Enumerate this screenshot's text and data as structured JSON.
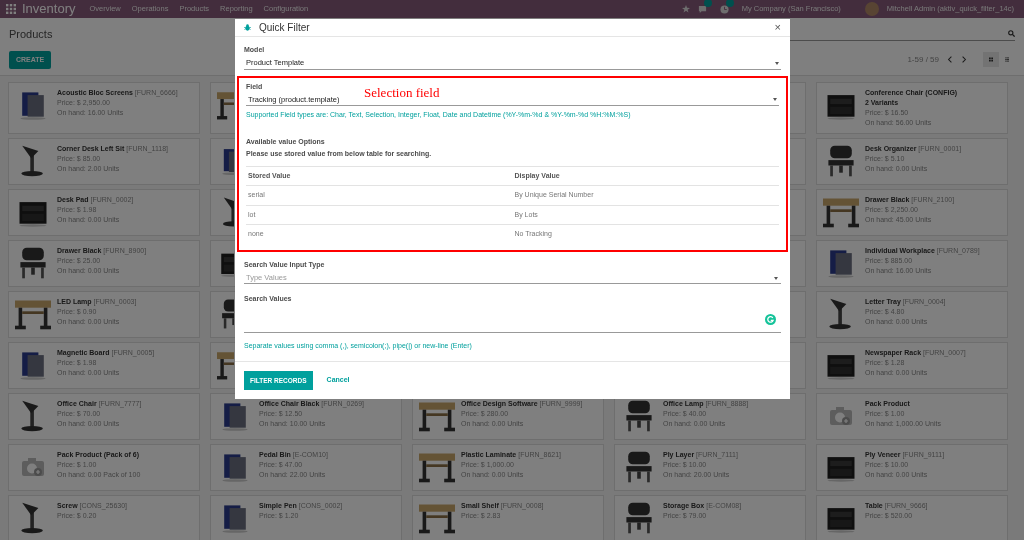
{
  "app": {
    "name": "Inventory",
    "menu": [
      "Overview",
      "Operations",
      "Products",
      "Reporting",
      "Configuration"
    ],
    "company": "My Company (San Francisco)",
    "user": "Mitchell Admin (aktiv_quick_filter_14c)"
  },
  "control_panel": {
    "title": "Products",
    "create_button": "CREATE",
    "pager": "1-59 / 59",
    "views": [
      {
        "kind": "kanban",
        "selected": true
      },
      {
        "kind": "list",
        "selected": false
      }
    ]
  },
  "products": [
    {
      "name": "Acoustic Bloc Screens",
      "code": "[FURN_6666]",
      "price": "Price: $ 2,950.00",
      "on_hand": "On hand: 16.00 Units"
    },
    {
      "kind": "covered"
    },
    {
      "kind": "covered"
    },
    {
      "name": "Conference Chair (CONFIG)",
      "variants": "2 Variants",
      "price": "Price: $ 16.50",
      "on_hand": "On hand: 56.00 Units"
    },
    {
      "name": "Corner Desk Left Sit",
      "code": "[FURN_1118]",
      "price": "Price: $ 85.00",
      "on_hand": "On hand: 2.00 Units"
    },
    {
      "kind": "covered"
    },
    {
      "kind": "covered"
    },
    {
      "name": "Desk Organizer",
      "code": "[FURN_0001]",
      "price": "Price: $ 5.10",
      "on_hand": "On hand: 0.00 Units"
    },
    {
      "name": "Desk Pad",
      "code": "[FURN_0002]",
      "price": "Price: $ 1.98",
      "on_hand": "On hand: 0.00 Units"
    },
    {
      "kind": "covered"
    },
    {
      "kind": "covered"
    },
    {
      "name": "Drawer Black",
      "code": "[FURN_2100]",
      "price": "Price: $ 2,250.00",
      "on_hand": "On hand: 45.00 Units"
    },
    {
      "name": "Drawer Black",
      "code": "[FURN_8900]",
      "price": "Price: $ 25.00",
      "on_hand": "On hand: 0.00 Units"
    },
    {
      "kind": "covered"
    },
    {
      "kind": "covered"
    },
    {
      "name": "Individual Workplace",
      "code": "[FURN_0789]",
      "price": "Price: $ 885.00",
      "on_hand": "On hand: 16.00 Units"
    },
    {
      "name": "LED Lamp",
      "code": "[FURN_0003]",
      "price": "Price: $ 0.90",
      "on_hand": "On hand: 0.00 Units"
    },
    {
      "kind": "covered"
    },
    {
      "kind": "covered"
    },
    {
      "name": "Letter Tray",
      "code": "[FURN_0004]",
      "price": "Price: $ 4.80",
      "on_hand": "On hand: 0.00 Units"
    },
    {
      "name": "Magnetic Board",
      "code": "[FURN_0005]",
      "price": "Price: $ 1.98",
      "on_hand": "On hand: 0.00 Units"
    },
    {
      "kind": "covered"
    },
    {
      "kind": "covered"
    },
    {
      "name": "Newspaper Rack",
      "code": "[FURN_0007]",
      "price": "Price: $ 1.28",
      "on_hand": "On hand: 0.00 Units"
    },
    {
      "name": "Office Chair",
      "code": "[FURN_7777]",
      "price": "Price: $ 70.00",
      "on_hand": "On hand: 0.00 Units"
    },
    {
      "name": "Office Chair Black",
      "code": "[FURN_0269]",
      "price": "Price: $ 12.50",
      "on_hand": "On hand: 10.00 Units"
    },
    {
      "name": "Office Design Software",
      "code": "[FURN_9999]",
      "price": "Price: $ 280.00",
      "on_hand": "On hand: 0.00 Units"
    },
    {
      "name": "Office Lamp",
      "code": "[FURN_8888]",
      "price": "Price: $ 40.00",
      "on_hand": "On hand: 0.00 Units"
    },
    {
      "kind": "placeholder",
      "name": "Pack Product",
      "price": "Price: $ 1.00",
      "on_hand": "On hand: 1,000.00 Units"
    },
    {
      "kind": "placeholder",
      "name": "Pack Product (Pack of 6)",
      "price": "Price: $ 1.00",
      "on_hand": "On hand: 0.00 Pack of 100"
    },
    {
      "name": "Pedal Bin",
      "code": "[E-COM10]",
      "price": "Price: $ 47.00",
      "on_hand": "On hand: 22.00 Units"
    },
    {
      "name": "Plastic Laminate",
      "code": "[FURN_8621]",
      "price": "Price: $ 1,000.00",
      "on_hand": "On hand: 0.00 Units"
    },
    {
      "name": "Ply Layer",
      "code": "[FURN_7111]",
      "price": "Price: $ 10.00",
      "on_hand": "On hand: 20.00 Units"
    },
    {
      "name": "Ply Veneer",
      "code": "[FURN_9111]",
      "price": "Price: $ 10.00",
      "on_hand": "On hand: 0.00 Units"
    },
    {
      "name": "Screw",
      "code": "[CONS_25630]",
      "price": "Price: $ 0.20"
    },
    {
      "name": "Simple Pen",
      "code": "[CONS_0002]",
      "price": "Price: $ 1.20"
    },
    {
      "name": "Small Shelf",
      "code": "[FURN_0008]",
      "price": "Price: $ 2.83"
    },
    {
      "name": "Storage Box",
      "code": "[E-COM08]",
      "price": "Price: $ 79.00"
    },
    {
      "name": "Table",
      "code": "[FURN_9666]",
      "price": "Price: $ 520.00"
    }
  ],
  "dialog": {
    "title": "Quick Filter",
    "close": "×",
    "model": {
      "label": "Model",
      "value": "Product Template"
    },
    "field": {
      "label": "Field",
      "value": "Tracking (product.template)",
      "help": "Supported Field types are: Char, Text, Selection, Integer, Float, Date and Datetime (%Y-%m-%d & %Y-%m-%d %H:%M:%S)"
    },
    "options": {
      "title": "Available value Options",
      "note": "Please use stored value from below table for searching.",
      "columns": [
        "Stored Value",
        "Display Value"
      ],
      "rows": [
        [
          "serial",
          "By Unique Serial Number"
        ],
        [
          "lot",
          "By Lots"
        ],
        [
          "none",
          "No Tracking"
        ]
      ]
    },
    "input_type": {
      "label": "Search Value Input Type",
      "placeholder": "Type Values"
    },
    "search_values": {
      "label": "Search Values",
      "help": "Separate values using comma (,), semicolon(;), pipe(|) or new-line (Enter)"
    },
    "buttons": [
      {
        "kind": "primary",
        "label": "FILTER RECORDS"
      },
      {
        "kind": "link",
        "label": "Cancel"
      }
    ]
  },
  "annotation": {
    "text": "Selection field"
  }
}
